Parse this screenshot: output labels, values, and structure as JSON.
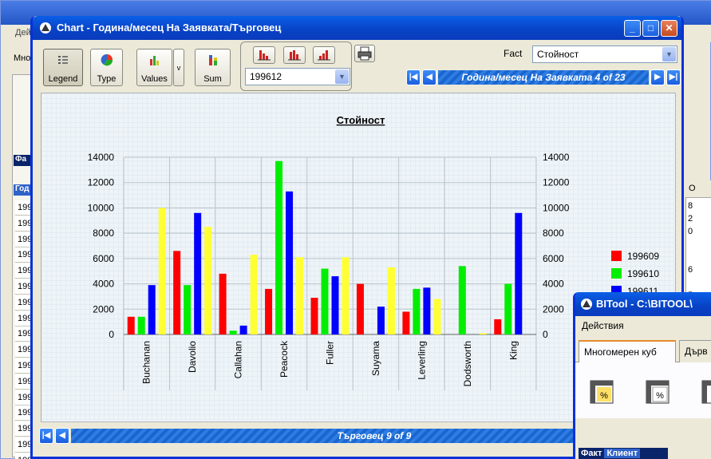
{
  "background_window": {
    "menu_label": "Дей",
    "tab_label": "Мно",
    "fa_label": "Фа",
    "god_label": "Год",
    "rows": [
      "199",
      "199",
      "199",
      "199",
      "199",
      "199",
      "199",
      "199",
      "199",
      "199",
      "199",
      "199",
      "199",
      "199",
      "199",
      "199",
      "199"
    ],
    "right_header": "О",
    "right_values": [
      "8",
      "2",
      "0",
      "",
      "",
      "6",
      "",
      "5"
    ]
  },
  "chart_window": {
    "title": "Chart - Година/месец На Заявката/Търговец",
    "toolbar": {
      "legend_label": "Legend",
      "type_label": "Type",
      "values_label": "Values",
      "values_dropdown_glyph": "v",
      "sum_label": "Sum"
    },
    "period_select": {
      "value": "199612"
    },
    "fact": {
      "label": "Fact",
      "value": "Стойност"
    },
    "nav_top_text": "Година/месец На Заявката 4 of 23",
    "nav_bottom_text": "Търговец 9 of 9"
  },
  "chart_data": {
    "type": "bar",
    "title": "Стойност",
    "categories": [
      "Buchanan",
      "Davolio",
      "Callahan",
      "Peacock",
      "Fuller",
      "Suyama",
      "Leverling",
      "Dodsworth",
      "King"
    ],
    "series": [
      {
        "name": "199609",
        "color": "#ff0000",
        "values": [
          1400,
          6600,
          4800,
          3600,
          2900,
          4000,
          1800,
          0,
          1200
        ]
      },
      {
        "name": "199610",
        "color": "#00ee00",
        "values": [
          1400,
          3900,
          300,
          13700,
          5200,
          0,
          3600,
          5400,
          4000
        ]
      },
      {
        "name": "199611",
        "color": "#0000ff",
        "values": [
          3900,
          9600,
          700,
          11300,
          4600,
          2200,
          3700,
          0,
          9600
        ]
      },
      {
        "name": "",
        "color": "#ffff33",
        "values": [
          10000,
          8500,
          6300,
          6100,
          6100,
          5300,
          2800,
          100,
          0
        ]
      }
    ],
    "yticks": [
      0,
      2000,
      4000,
      6000,
      8000,
      10000,
      12000,
      14000
    ],
    "ylim": [
      0,
      14000
    ],
    "grid": true,
    "legend": "right"
  },
  "bitool_window": {
    "title": "BITool - C:\\BITOOL\\",
    "menu_label": "Действия",
    "tab_active": "Многомерен куб",
    "tab_other": "Дърв",
    "status_left": "Факт",
    "status_right": "Клиент"
  }
}
